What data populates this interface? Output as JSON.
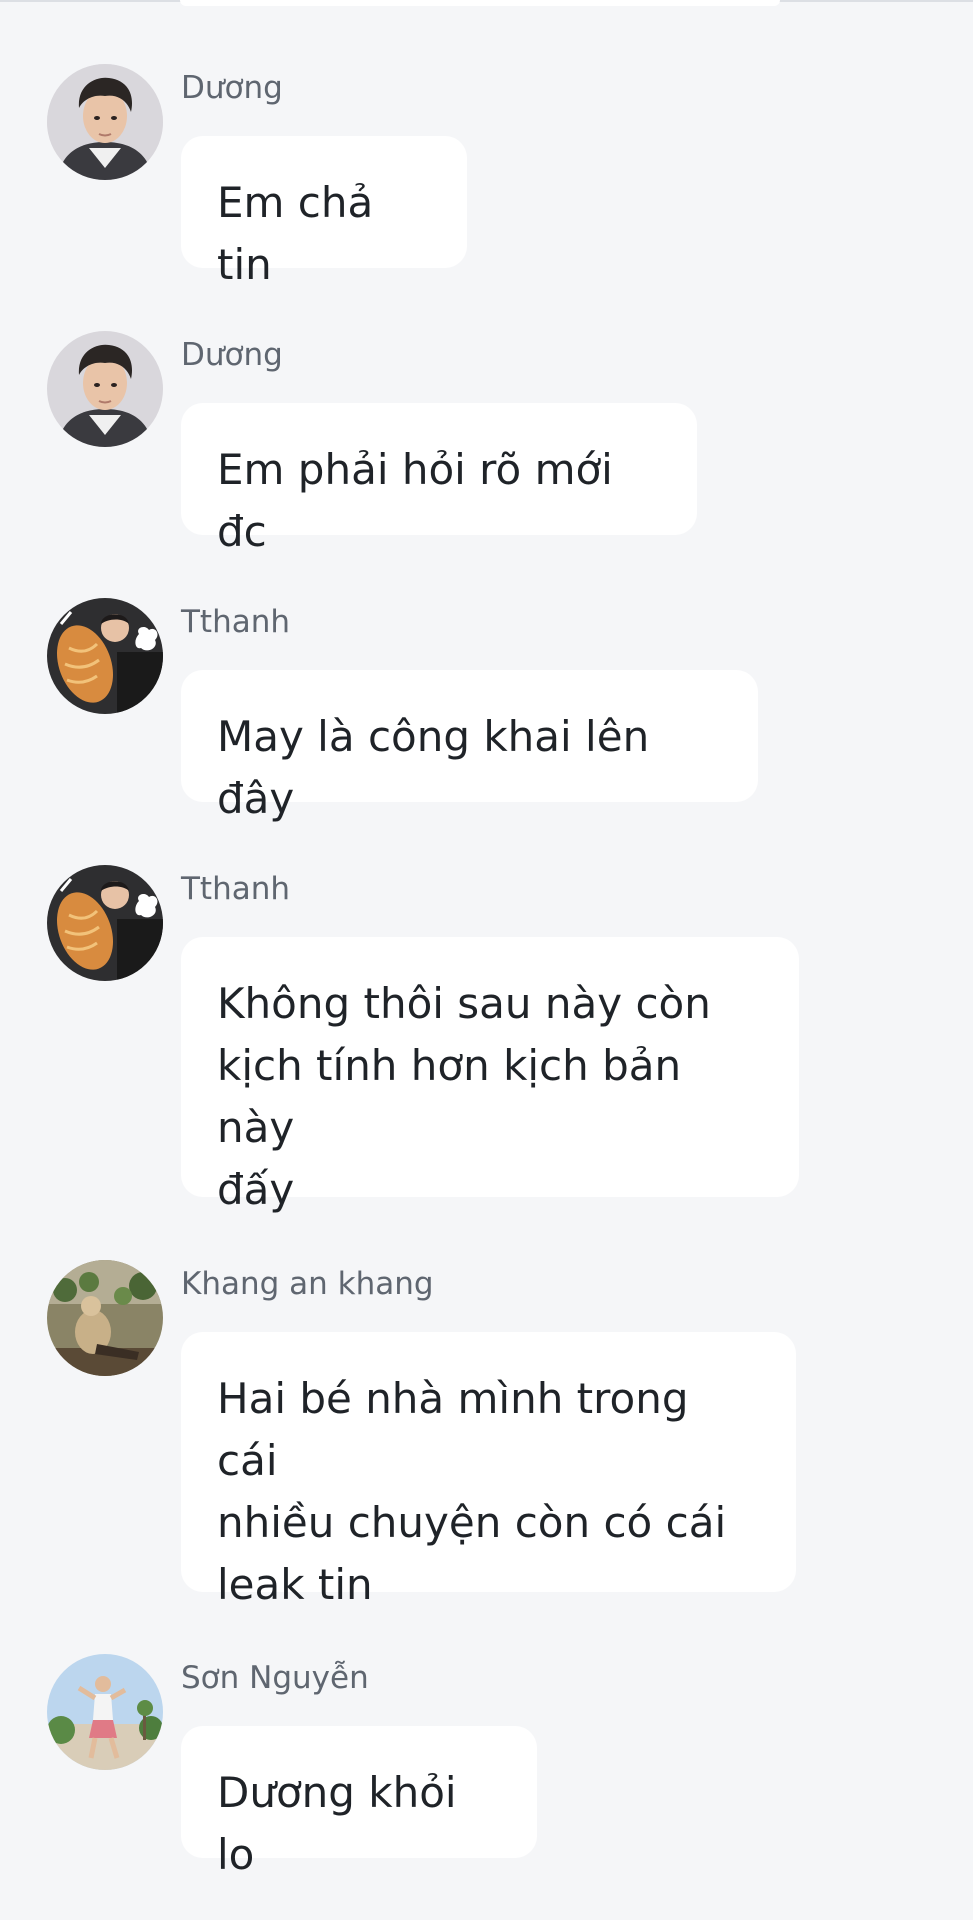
{
  "messages": [
    {
      "sender": "Dương",
      "avatar": "avatar-duong",
      "text": "Em chả tin"
    },
    {
      "sender": "Dương",
      "avatar": "avatar-duong",
      "text": "Em phải hỏi rõ mới đc"
    },
    {
      "sender": "Tthanh",
      "avatar": "avatar-tthanh",
      "text": "May là công khai lên đây"
    },
    {
      "sender": "Tthanh",
      "avatar": "avatar-tthanh",
      "text_lines": [
        "Không thôi sau này còn",
        "kịch tính hơn kịch bản này",
        "đấy"
      ]
    },
    {
      "sender": "Khang an khang",
      "avatar": "avatar-khang",
      "text_lines": [
        "Hai bé nhà mình trong cái",
        "nhiều chuyện còn có cái",
        "leak tin"
      ]
    },
    {
      "sender": "Sơn Nguyễn",
      "avatar": "avatar-son",
      "text": "Dương khỏi lo"
    }
  ],
  "colors": {
    "background": "#f5f6f8",
    "bubble": "#ffffff",
    "sender_text": "#5f6670",
    "message_text": "#1f2328"
  }
}
